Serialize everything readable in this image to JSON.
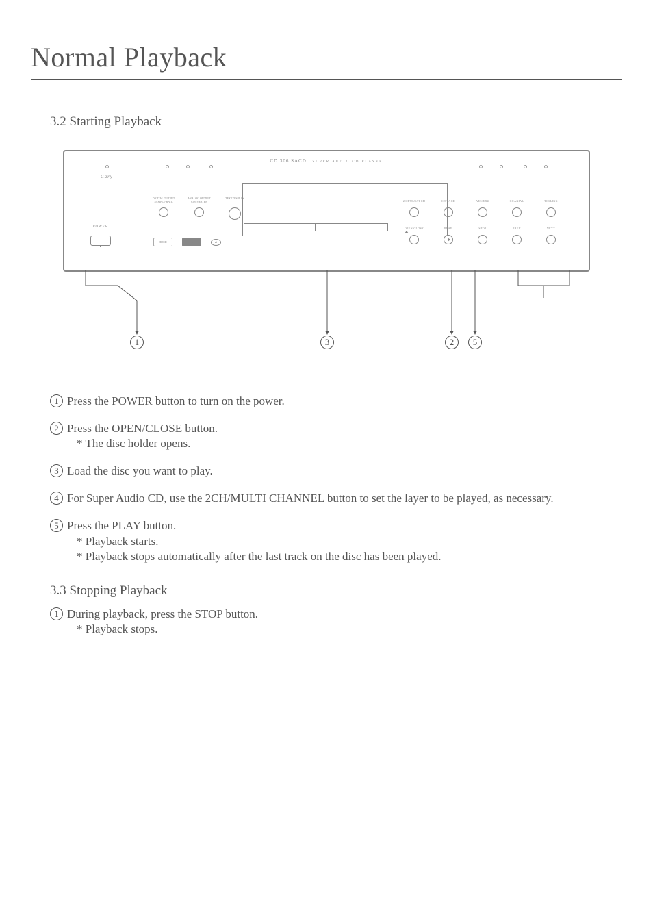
{
  "title": "Normal Playback",
  "section_3_2": "3.2 Starting Playback",
  "section_3_3": "3.3 Stopping Playback",
  "panel": {
    "product": "CD 306 SACD",
    "product_sub": "SUPER AUDIO  CD PLAYER",
    "logo": "Cary",
    "power_label": "POWER",
    "g3": {
      "c1": "DIGITAL\nOUTPUT\nSAMPLE-RATE",
      "c2": "ANALOG\nOUTPUT\nCONVERTER",
      "c3": "TEXT\nDISPLAY"
    },
    "logos": {
      "a": "HDCD",
      "b": "dts",
      "c": "⇄"
    },
    "right_top": {
      "c1": "2CH/MULTI CH",
      "c2": "CD/SACD",
      "c3": "AES/EBU",
      "c4": "COAXIAL",
      "c5": "TOSLINK"
    },
    "right_bottom": {
      "c1": "OPEN/CLOSE",
      "c2": "PLAY",
      "c3": "STOP",
      "c4": "PREV",
      "c5": "NEXT"
    }
  },
  "callout_nums": {
    "n1": "1",
    "n2": "2",
    "n3": "3",
    "n5": "5"
  },
  "steps_3_2": [
    {
      "n": "1",
      "text": "Press the POWER button to turn on the power."
    },
    {
      "n": "2",
      "text": "Press the OPEN/CLOSE button.",
      "subs": [
        "* The disc holder opens."
      ]
    },
    {
      "n": "3",
      "text": "Load the disc you want to play."
    },
    {
      "n": "4",
      "text": "For Super Audio CD, use the 2CH/MULTI CHANNEL button to set the layer to be played, as necessary."
    },
    {
      "n": "5",
      "text": "Press the PLAY button.",
      "subs": [
        "* Playback starts.",
        "* Playback stops automatically after the last track on the disc has been played."
      ]
    }
  ],
  "steps_3_3": [
    {
      "n": "1",
      "text": "During playback, press the STOP button.",
      "subs": [
        "* Playback stops."
      ]
    }
  ]
}
